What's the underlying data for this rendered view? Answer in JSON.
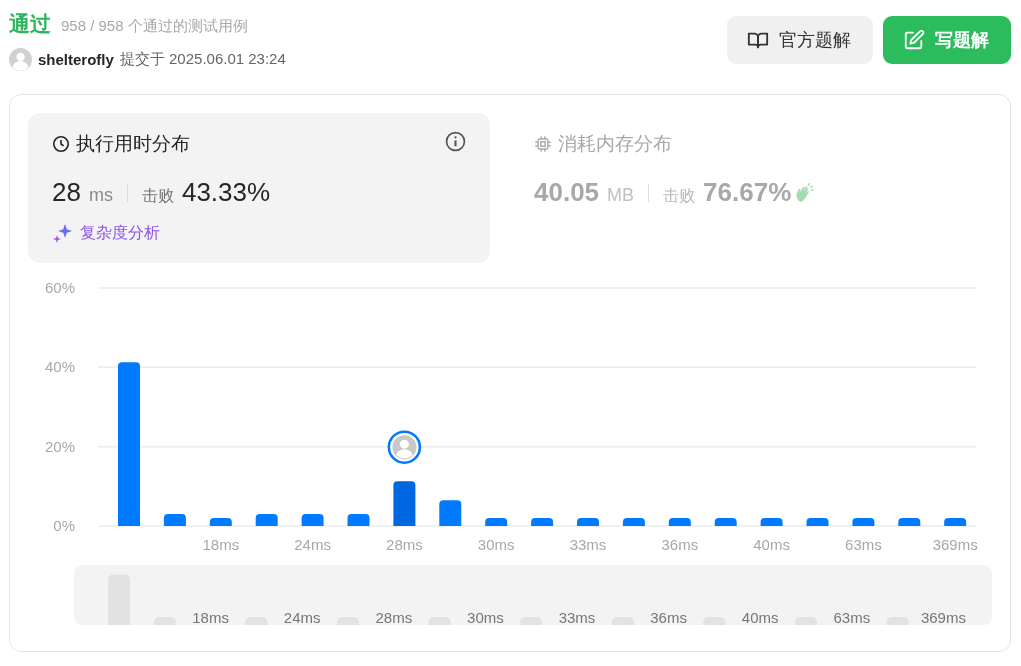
{
  "header": {
    "status": "通过",
    "cases": "958 / 958 个通过的测试用例",
    "user": "shelterofly",
    "submitted": "提交于 2025.06.01 23:24"
  },
  "buttons": [
    {
      "label": "官方题解",
      "kind": "secondary"
    },
    {
      "label": "写题解",
      "kind": "primary"
    }
  ],
  "stats": [
    {
      "kind": "time",
      "title": "执行用时分布",
      "value": "28",
      "unit": "ms",
      "beat_label": "击败",
      "beat": "43.33%",
      "selected": true,
      "link": "复杂度分析"
    },
    {
      "kind": "memory",
      "title": "消耗内存分布",
      "value": "40.05",
      "unit": "MB",
      "beat_label": "击败",
      "beat": "76.67%",
      "selected": false
    }
  ],
  "chart": {
    "chart_data": {
      "type": "bar",
      "categories": [
        null,
        null,
        "18ms",
        null,
        "24ms",
        null,
        "28ms",
        null,
        "30ms",
        null,
        "33ms",
        null,
        "36ms",
        null,
        "40ms",
        null,
        "63ms",
        null,
        "369ms"
      ],
      "series": [
        {
          "color": "#007aff",
          "values": [
            41.3,
            3,
            2,
            3,
            3,
            3,
            null,
            6.5,
            2,
            2,
            2,
            2,
            2,
            2,
            2,
            2,
            2,
            2,
            2
          ]
        },
        {
          "color": "#0067e0",
          "values": [
            null,
            null,
            null,
            null,
            null,
            null,
            11.3,
            null,
            null,
            null,
            null,
            null,
            null,
            null,
            null,
            null,
            null,
            null,
            null
          ]
        }
      ],
      "ylim": [
        0,
        60
      ],
      "yticks": [
        {
          "value": 0,
          "label": "0%"
        },
        {
          "value": 20,
          "label": "20%"
        },
        {
          "value": 40,
          "label": "40%"
        },
        {
          "value": 60,
          "label": "60%"
        }
      ]
    }
  },
  "navigator": {
    "labels": [
      "18ms",
      "24ms",
      "28ms",
      "30ms",
      "33ms",
      "36ms",
      "40ms",
      "63ms",
      "369ms"
    ]
  }
}
